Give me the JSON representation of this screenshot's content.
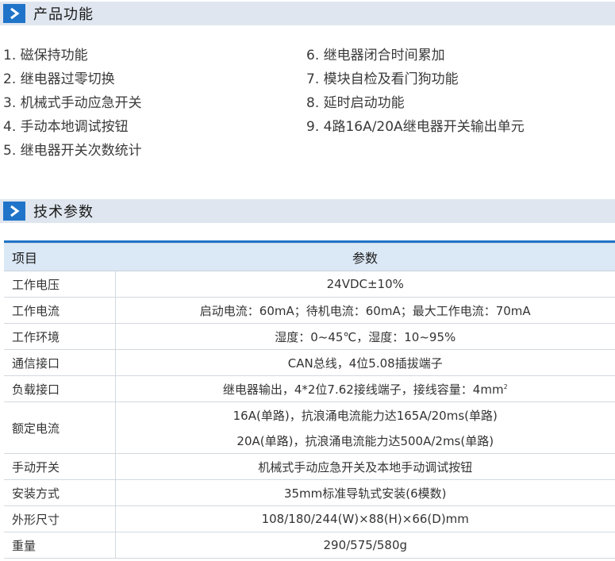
{
  "section1": {
    "title": "产品功能"
  },
  "features": {
    "left": [
      "1. 磁保持功能",
      "2. 继电器过零切换",
      "3. 机械式手动应急开关",
      "4. 手动本地调试按钮",
      "5. 继电器开关次数统计"
    ],
    "right": [
      "6. 继电器闭合时间累加",
      "7. 模块自检及看门狗功能",
      "8. 延时启动功能",
      "9. 4路16A/20A继电器开关输出单元"
    ]
  },
  "section2": {
    "title": "技术参数"
  },
  "table": {
    "header": {
      "item": "项目",
      "param": "参数"
    },
    "rows": [
      {
        "item": "工作电压",
        "value": "24VDC±10%"
      },
      {
        "item": "工作电流",
        "value": "启动电流：60mA；待机电流：60mA；最大工作电流：70mA"
      },
      {
        "item": "工作环境",
        "value": "湿度：0~45℃，湿度：10~95%"
      },
      {
        "item": "通信接口",
        "value": "CAN总线，4位5.08插拔端子"
      },
      {
        "item": "负载接口",
        "value": "继电器输出，4*2位7.62接线端子，接线容量：4mm",
        "sup": "2"
      },
      {
        "item": "额定电流",
        "value1": "16A(单路)，抗浪涌电流能力达165A/20ms(单路)",
        "value2": "20A(单路)，抗浪涌电流能力达500A/2ms(单路)"
      },
      {
        "item": "手动开关",
        "value": "机械式手动应急开关及本地手动调试按钮"
      },
      {
        "item": "安装方式",
        "value": "35mm标准导轨式安装(6模数)"
      },
      {
        "item": "外形尺寸",
        "value": "108/180/244(W)×88(H)×66(D)mm"
      },
      {
        "item": "重量",
        "value": "290/575/580g"
      }
    ]
  },
  "colors": {
    "accent": "#1f74c9",
    "header_bg": "#dfe6ef",
    "table_header_bg": "#dbe8f5"
  },
  "icons": {
    "section_marker": "chevron-right-icon"
  }
}
